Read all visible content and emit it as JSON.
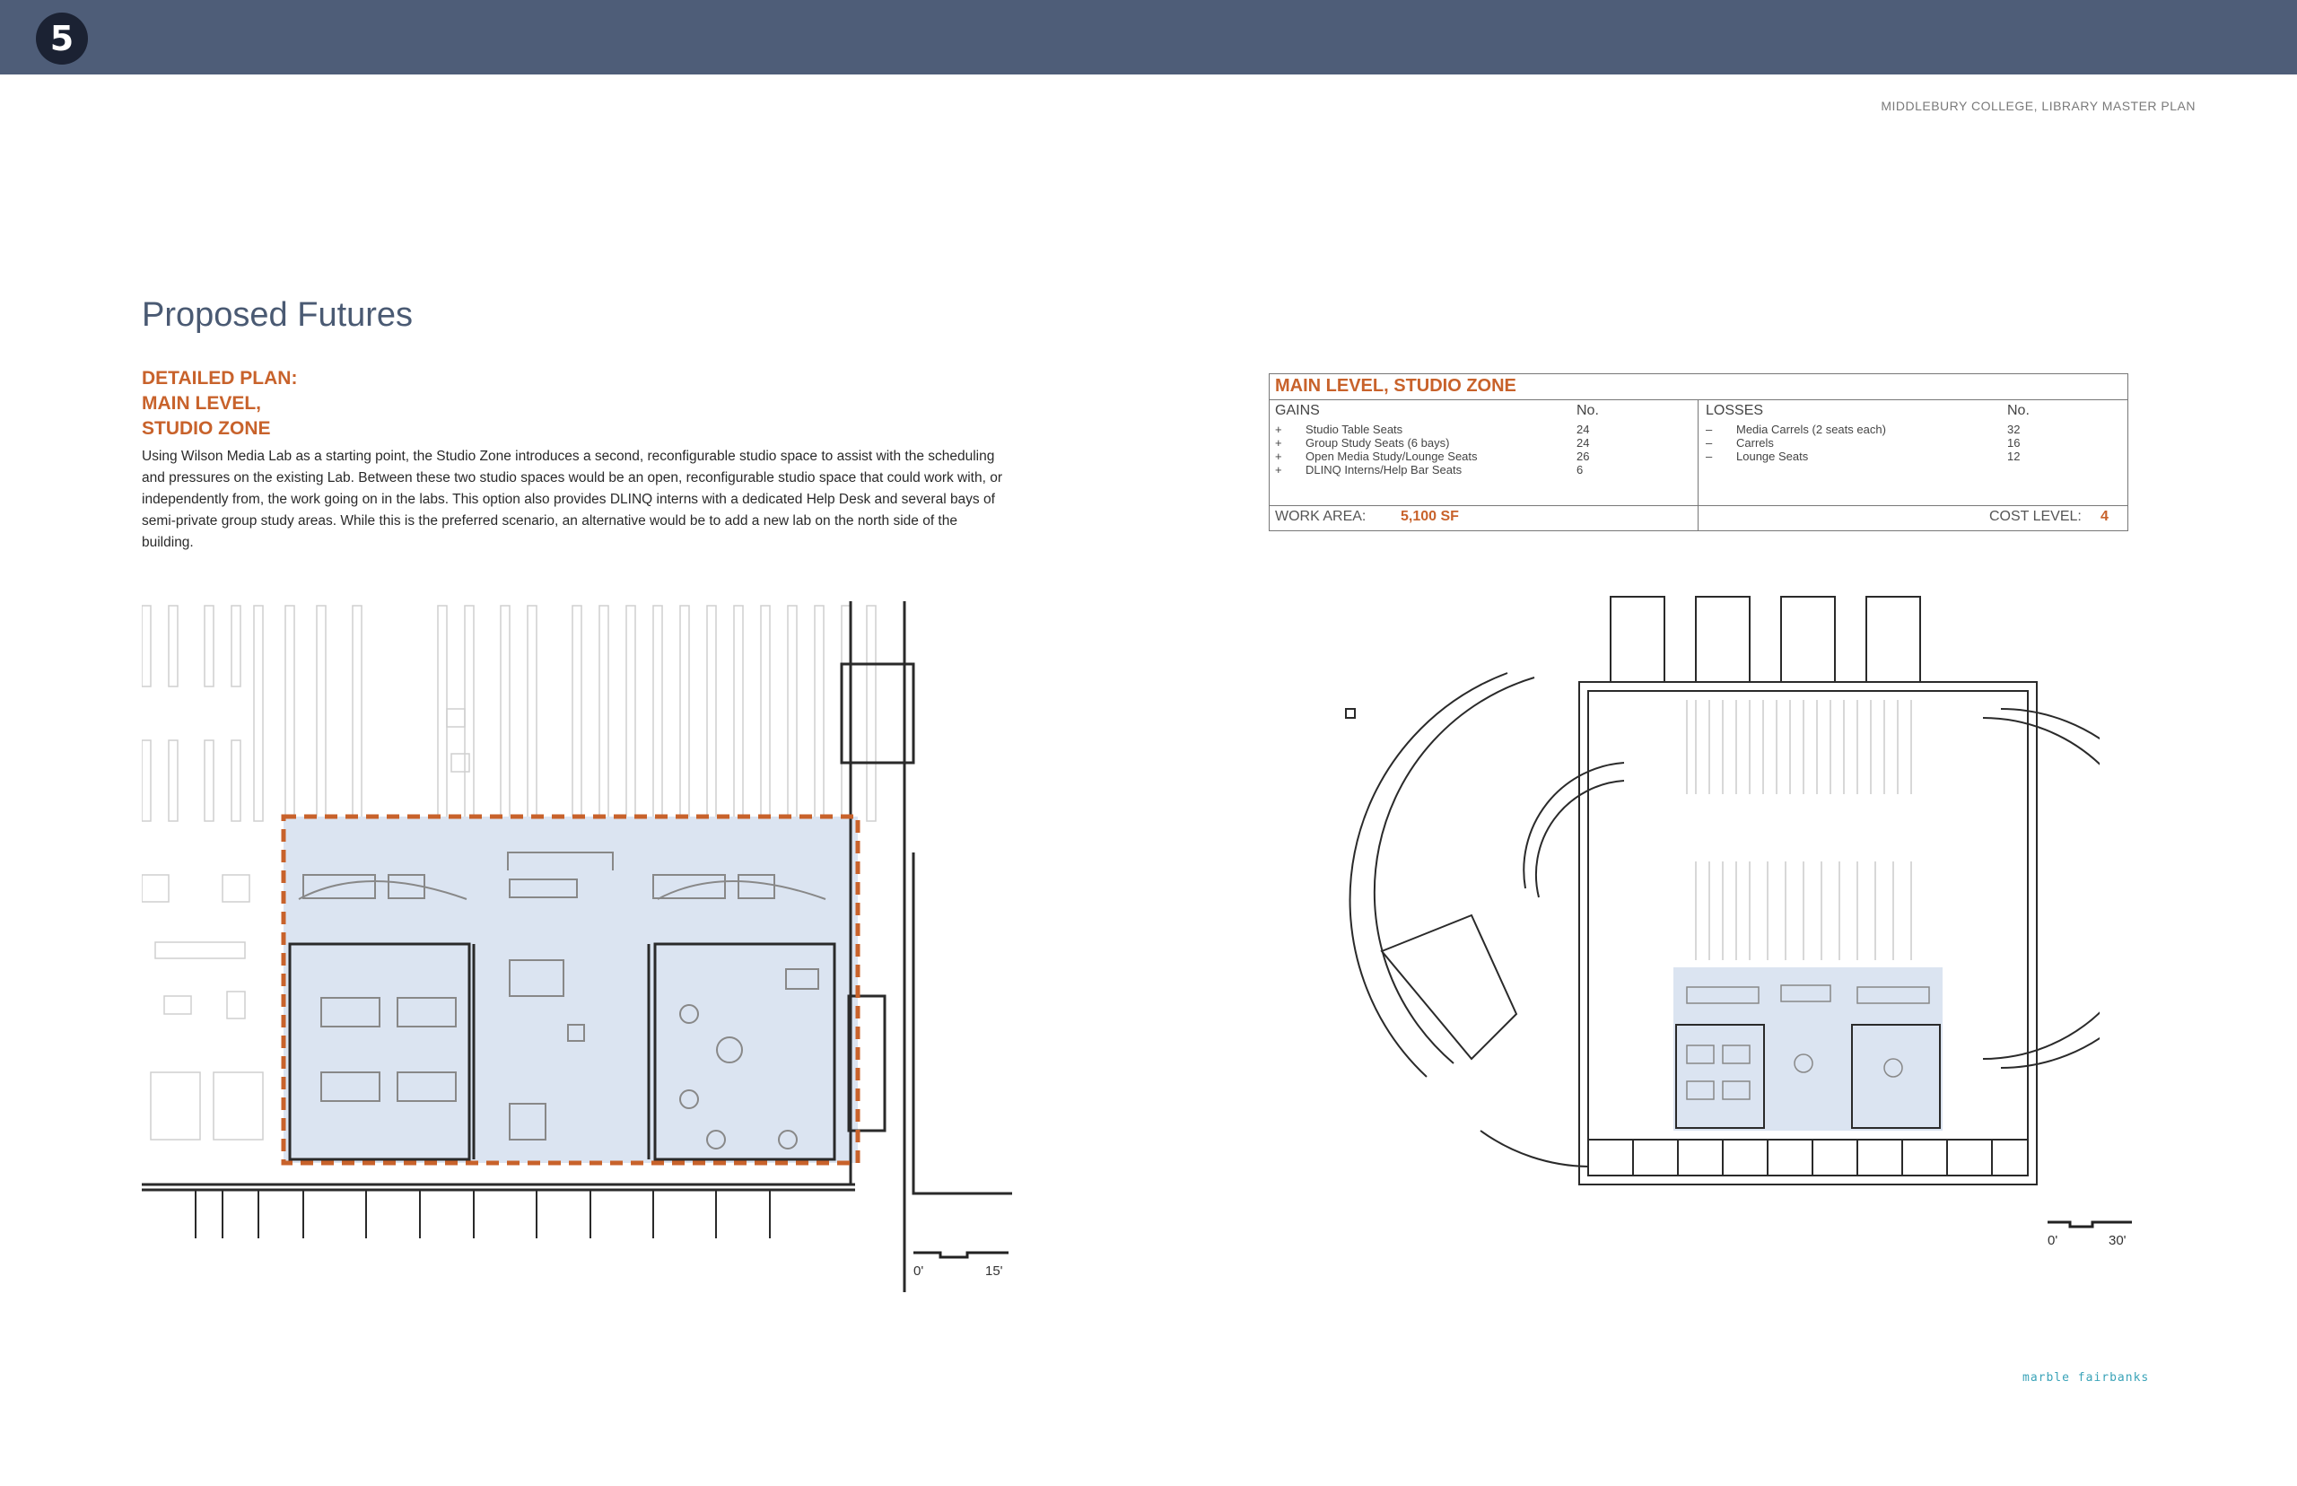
{
  "header": {
    "chapter_number": "5",
    "running_head": "MIDDLEBURY COLLEGE, LIBRARY MASTER PLAN"
  },
  "page": {
    "title": "Proposed Futures",
    "subtitle_lines": [
      "DETAILED PLAN:",
      "MAIN LEVEL,",
      "STUDIO ZONE"
    ],
    "body": "Using Wilson Media Lab as a starting point, the Studio Zone introduces a second, reconfigurable studio space to assist with the scheduling and pressures on the existing Lab. Between these two studio spaces would be an open, reconfigurable studio space that could work with, or independently from, the work going on in the labs. This option also provides DLINQ interns with a dedicated Help Desk and several bays of semi-private group study areas. While this is the preferred scenario, an alternative would be to add a new lab on the north side of the building."
  },
  "summary": {
    "title": "MAIN LEVEL, STUDIO ZONE",
    "gains_header": "GAINS",
    "losses_header": "LOSSES",
    "no_header": "No.",
    "gains": [
      {
        "sign": "+",
        "label": "Studio Table Seats",
        "value": "24"
      },
      {
        "sign": "+",
        "label": "Group Study Seats (6 bays)",
        "value": "24"
      },
      {
        "sign": "+",
        "label": "Open Media Study/Lounge Seats",
        "value": "26"
      },
      {
        "sign": "+",
        "label": "DLINQ Interns/Help Bar Seats",
        "value": "6"
      }
    ],
    "losses": [
      {
        "sign": "–",
        "label": "Media Carrels (2 seats each)",
        "value": "32"
      },
      {
        "sign": "–",
        "label": "Carrels",
        "value": "16"
      },
      {
        "sign": "–",
        "label": "Lounge Seats",
        "value": "12"
      }
    ],
    "work_area_label": "WORK AREA:",
    "work_area_value": "5,100 SF",
    "cost_level_label": "COST LEVEL:",
    "cost_level_value": "4"
  },
  "plans": {
    "left_scale_start": "0'",
    "left_scale_end": "15'",
    "right_scale_start": "0'",
    "right_scale_end": "30'"
  },
  "footer": {
    "logo_text": "marble fairbanks"
  },
  "colors": {
    "header_bar": "#4e5d78",
    "accent": "#c8622b",
    "title": "#4a5a73",
    "zone_fill": "#dbe4f1"
  }
}
